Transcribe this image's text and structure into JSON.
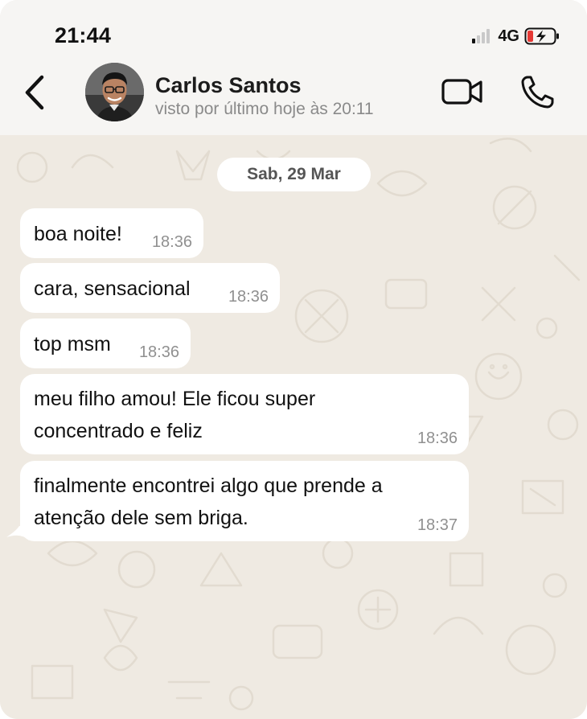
{
  "status_bar": {
    "time": "21:44",
    "network": "4G"
  },
  "header": {
    "contact_name": "Carlos Santos",
    "last_seen": "visto por último hoje às 20:11"
  },
  "chat": {
    "date_label": "Sab, 29 Mar",
    "messages": [
      {
        "text": "boa noite!",
        "time": "18:36"
      },
      {
        "text": "cara, sensacional",
        "time": "18:36"
      },
      {
        "text": "top msm",
        "time": "18:36"
      },
      {
        "text": "meu filho amou! Ele ficou super\nconcentrado e feliz",
        "time": "18:36"
      },
      {
        "text": "finalmente encontrei algo que prende a\natenção dele sem briga.",
        "time": "18:37"
      }
    ]
  },
  "icons": {
    "back": "chevron-left-icon",
    "video": "video-camera-icon",
    "call": "phone-icon",
    "signal": "signal-icon",
    "battery": "battery-charging-icon"
  },
  "colors": {
    "chat_background": "#efeae2",
    "header_background": "#f6f5f3",
    "bubble": "#ffffff",
    "battery_low": "#e53935"
  }
}
